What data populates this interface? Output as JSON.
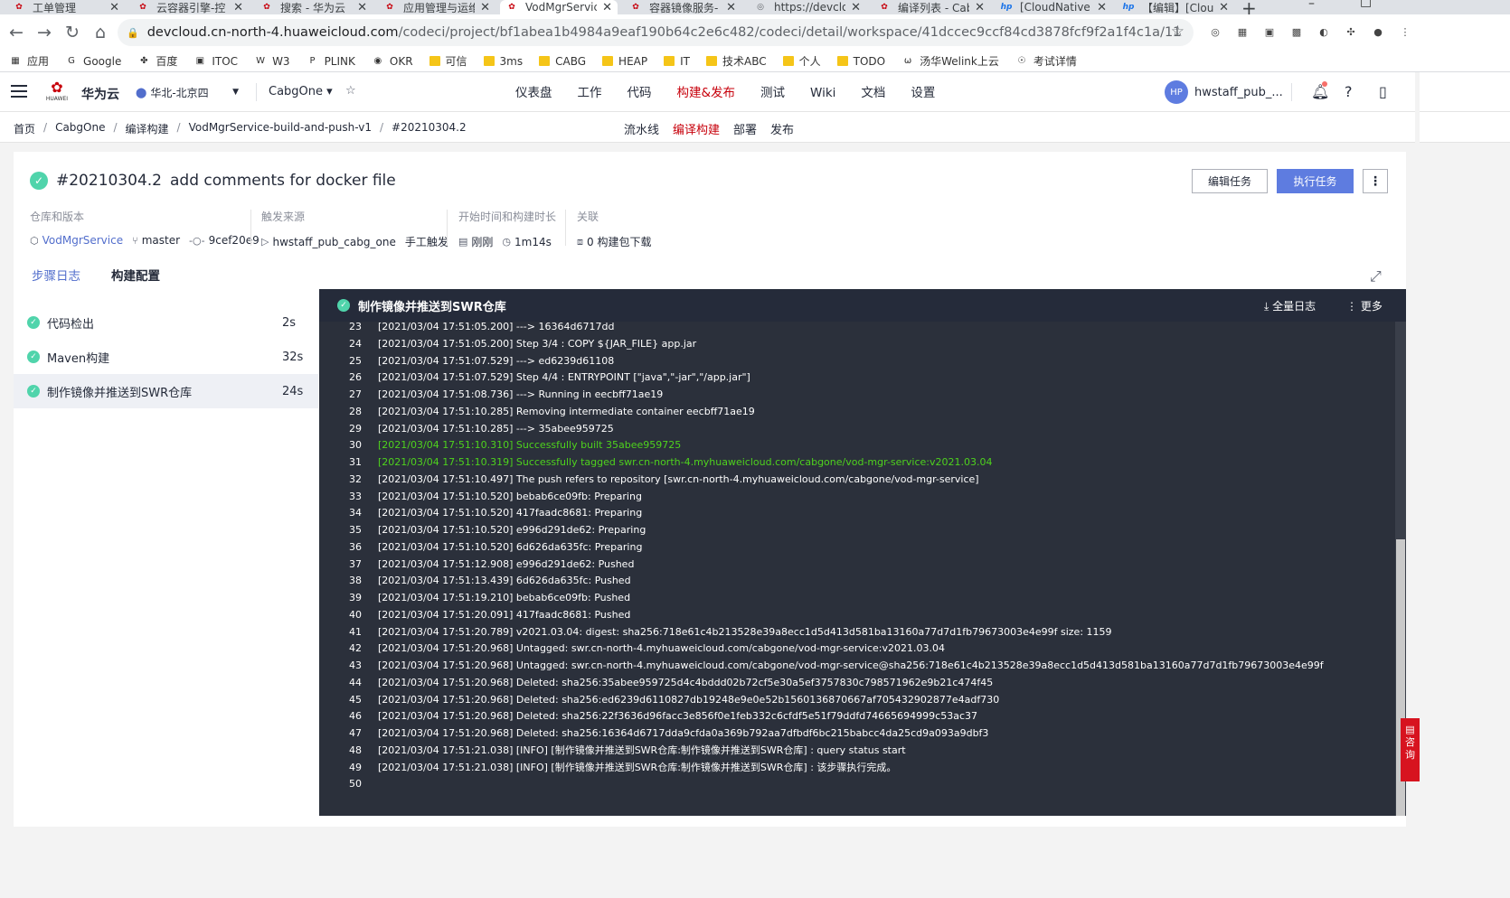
{
  "browser": {
    "tabs": [
      {
        "title": "工单管理",
        "fav": "hw"
      },
      {
        "title": "云容器引擎-控",
        "fav": "hw"
      },
      {
        "title": "搜索 - 华为云",
        "fav": "hw"
      },
      {
        "title": "应用管理与运维",
        "fav": "hw"
      },
      {
        "title": "VodMgrServic",
        "fav": "hw"
      },
      {
        "title": "容器镜像服务-",
        "fav": "hw"
      },
      {
        "title": "https://devclo",
        "fav": "globe"
      },
      {
        "title": "编译列表 - Cab",
        "fav": "hw"
      },
      {
        "title": "[CloudNative]",
        "fav": "hp"
      },
      {
        "title": "【编辑】[Clou",
        "fav": "hp"
      }
    ],
    "active_tab": 4,
    "url_host": "devcloud.cn-north-4.huaweicloud.com",
    "url_path": "/codeci/project/bf1abea1b4984a9eaf190b64c2e6c482/codeci/detail/workspace/41dccec9ccf84cd3878fcf9f2a1f4c1a/11",
    "bookmarks": [
      "应用",
      "Google",
      "百度",
      "ITOC",
      "W3",
      "PLINK",
      "OKR",
      "可信",
      "3ms",
      "CABG",
      "HEAP",
      "IT",
      "技术ABC",
      "个人",
      "TODO",
      "汤华Welink上云",
      "考试详情"
    ]
  },
  "header": {
    "logo_word": "HUAWEI",
    "brand": "华为云",
    "region": "华北-北京四",
    "project": "CabgOne",
    "nav": [
      "仪表盘",
      "工作",
      "代码",
      "构建&发布",
      "测试",
      "Wiki",
      "文档",
      "设置"
    ],
    "nav_active": 3,
    "avatar": "HP",
    "username": "hwstaff_pub_..."
  },
  "subbar": {
    "breadcrumb": [
      "首页",
      "CabgOne",
      "编译构建",
      "VodMgrService-build-and-push-v1",
      "#20210304.2"
    ],
    "subnav": [
      "流水线",
      "编译构建",
      "部署",
      "发布"
    ],
    "subnav_active": 1
  },
  "build": {
    "number": "#20210304.2",
    "desc": "add comments for docker file",
    "edit_label": "编辑任务",
    "run_label": "执行任务",
    "meta": {
      "repo_label": "仓库和版本",
      "repo": "VodMgrService",
      "branch": "master",
      "commit": "9cef20e9",
      "trigger_label": "触发来源",
      "trigger_user": "hwstaff_pub_cabg_one",
      "trigger_type": "手工触发",
      "time_label": "开始时间和构建时长",
      "start": "刚刚",
      "duration": "1m14s",
      "assoc_label": "关联",
      "artifacts": "0 构建包下载"
    },
    "tabs": [
      "步骤日志",
      "构建配置"
    ],
    "tab_active": 0
  },
  "steps": [
    {
      "name": "代码检出",
      "duration": "2s"
    },
    {
      "name": "Maven构建",
      "duration": "32s"
    },
    {
      "name": "制作镜像并推送到SWR仓库",
      "duration": "24s"
    }
  ],
  "step_active": 2,
  "log": {
    "title": "制作镜像并推送到SWR仓库",
    "full_log": "全量日志",
    "more": "更多",
    "lines": [
      {
        "n": "23",
        "t": "[2021/03/04 17:51:05.200] ---> 16364d6717dd"
      },
      {
        "n": "24",
        "t": "[2021/03/04 17:51:05.200] Step 3/4 : COPY ${JAR_FILE} app.jar"
      },
      {
        "n": "25",
        "t": "[2021/03/04 17:51:07.529] ---> ed6239d61108"
      },
      {
        "n": "26",
        "t": "[2021/03/04 17:51:07.529] Step 4/4 : ENTRYPOINT [\"java\",\"-jar\",\"/app.jar\"]"
      },
      {
        "n": "27",
        "t": "[2021/03/04 17:51:08.736] ---> Running in eecbff71ae19"
      },
      {
        "n": "28",
        "t": "[2021/03/04 17:51:10.285] Removing intermediate container eecbff71ae19"
      },
      {
        "n": "29",
        "t": "[2021/03/04 17:51:10.285] ---> 35abee959725"
      },
      {
        "n": "30",
        "t": "[2021/03/04 17:51:10.310] Successfully built 35abee959725",
        "g": true
      },
      {
        "n": "31",
        "t": "[2021/03/04 17:51:10.319] Successfully tagged swr.cn-north-4.myhuaweicloud.com/cabgone/vod-mgr-service:v2021.03.04",
        "g": true
      },
      {
        "n": "32",
        "t": "[2021/03/04 17:51:10.497] The push refers to repository [swr.cn-north-4.myhuaweicloud.com/cabgone/vod-mgr-service]"
      },
      {
        "n": "33",
        "t": "[2021/03/04 17:51:10.520] bebab6ce09fb: Preparing"
      },
      {
        "n": "34",
        "t": "[2021/03/04 17:51:10.520] 417faadc8681: Preparing"
      },
      {
        "n": "35",
        "t": "[2021/03/04 17:51:10.520] e996d291de62: Preparing"
      },
      {
        "n": "36",
        "t": "[2021/03/04 17:51:10.520] 6d626da635fc: Preparing"
      },
      {
        "n": "37",
        "t": "[2021/03/04 17:51:12.908] e996d291de62: Pushed"
      },
      {
        "n": "38",
        "t": "[2021/03/04 17:51:13.439] 6d626da635fc: Pushed"
      },
      {
        "n": "39",
        "t": "[2021/03/04 17:51:19.210] bebab6ce09fb: Pushed"
      },
      {
        "n": "40",
        "t": "[2021/03/04 17:51:20.091] 417faadc8681: Pushed"
      },
      {
        "n": "41",
        "t": "[2021/03/04 17:51:20.789] v2021.03.04: digest: sha256:718e61c4b213528e39a8ecc1d5d413d581ba13160a77d7d1fb79673003e4e99f size: 1159"
      },
      {
        "n": "42",
        "t": "[2021/03/04 17:51:20.968] Untagged: swr.cn-north-4.myhuaweicloud.com/cabgone/vod-mgr-service:v2021.03.04"
      },
      {
        "n": "43",
        "t": "[2021/03/04 17:51:20.968] Untagged: swr.cn-north-4.myhuaweicloud.com/cabgone/vod-mgr-service@sha256:718e61c4b213528e39a8ecc1d5d413d581ba13160a77d7d1fb79673003e4e99f"
      },
      {
        "n": "44",
        "t": "[2021/03/04 17:51:20.968] Deleted: sha256:35abee959725d4c4bddd02b72cf5e30a5ef3757830c798571962e9b21c474f45"
      },
      {
        "n": "45",
        "t": "[2021/03/04 17:51:20.968] Deleted: sha256:ed6239d6110827db19248e9e0e52b1560136870667af705432902877e4adf730"
      },
      {
        "n": "46",
        "t": "[2021/03/04 17:51:20.968] Deleted: sha256:22f3636d96facc3e856f0e1feb332c6cfdf5e51f79ddfd74665694999c53ac37"
      },
      {
        "n": "47",
        "t": "[2021/03/04 17:51:20.968] Deleted: sha256:16364d6717dda9cfda0a369b792aa7dfbdf6bc215babcc4da25cd9a093a9dbf3"
      },
      {
        "n": "48",
        "t": "[2021/03/04 17:51:21.038] [INFO] [制作镜像并推送到SWR仓库:制作镜像并推送到SWR仓库] : query status start"
      },
      {
        "n": "49",
        "t": "[2021/03/04 17:51:21.038] [INFO] [制作镜像并推送到SWR仓库:制作镜像并推送到SWR仓库] : 该步骤执行完成。"
      },
      {
        "n": "50",
        "t": ""
      }
    ]
  },
  "consult_label": "咨询",
  "colors": {
    "brand_red": "#c7000b",
    "primary": "#5e7ce0",
    "success": "#50d4ab",
    "log_bg": "#2b303b",
    "log_green": "#4ed21d"
  }
}
